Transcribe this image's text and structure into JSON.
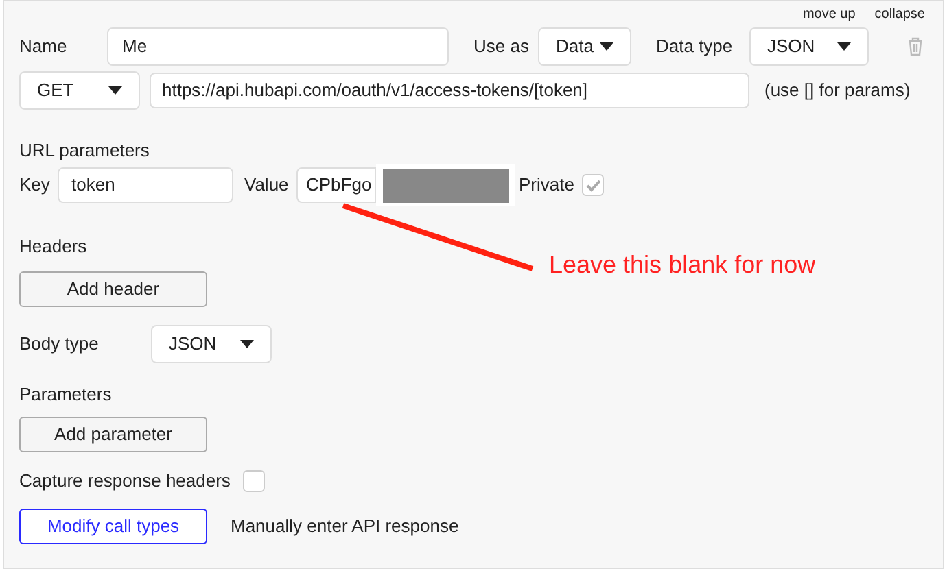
{
  "top_links": [
    "move up",
    "collapse"
  ],
  "name_label": "Name",
  "name_value": "Me",
  "use_as": {
    "label": "Use as",
    "value": "Data"
  },
  "data_type": {
    "label": "Data type",
    "value": "JSON"
  },
  "method": "GET",
  "url": "https://api.hubapi.com/oauth/v1/access-tokens/[token]",
  "url_hint": "(use [] for params)",
  "url_parameters": {
    "title": "URL parameters",
    "key_label": "Key",
    "key_value": "token",
    "value_label": "Value",
    "value_value": "CPbFgo",
    "private_label": "Private",
    "private_checked": true
  },
  "headers": {
    "title": "Headers",
    "button": "Add header"
  },
  "body_type": {
    "label": "Body type",
    "value": "JSON"
  },
  "parameters": {
    "title": "Parameters",
    "button": "Add parameter"
  },
  "capture": {
    "label": "Capture response headers",
    "checked": false
  },
  "modify_button": "Modify call types",
  "manual_link": "Manually enter API response",
  "annotation": "Leave this blank for now"
}
